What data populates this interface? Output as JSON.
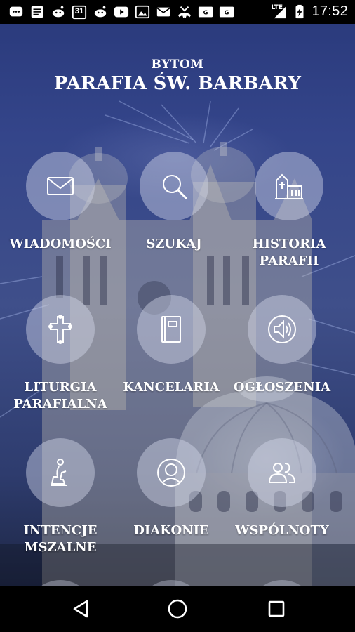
{
  "status_bar": {
    "time": "17:52",
    "network": "LTE",
    "icons": [
      "messenger-icon",
      "notes-icon",
      "reddit-icon",
      "calendar-icon",
      "reddit-icon",
      "youtube-icon",
      "image-icon",
      "mail-icon",
      "missed-call-icon",
      "gmail-icon",
      "gmail-icon"
    ],
    "calendar_day": "31"
  },
  "header": {
    "city": "BYTOM",
    "title": "PARAFIA ŚW. BARBARY"
  },
  "menu": [
    {
      "label": "WIADOMOŚCI",
      "icon": "envelope-icon"
    },
    {
      "label": "SZUKAJ",
      "icon": "magnifier-icon"
    },
    {
      "label": "HISTORIA\nPARAFII",
      "icon": "church-building-icon"
    },
    {
      "label": "LITURGIA\nPARAFIALNA",
      "icon": "cross-icon"
    },
    {
      "label": "KANCELARIA",
      "icon": "book-icon"
    },
    {
      "label": "OGŁOSZENIA",
      "icon": "speaker-icon"
    },
    {
      "label": "INTENCJE\nMSZALNE",
      "icon": "kneeling-person-icon"
    },
    {
      "label": "DIAKONIE",
      "icon": "person-icon"
    },
    {
      "label": "WSPÓLNOTY",
      "icon": "group-icon"
    }
  ],
  "colors": {
    "background": "#34458a",
    "tile": "#d2d6e8"
  }
}
